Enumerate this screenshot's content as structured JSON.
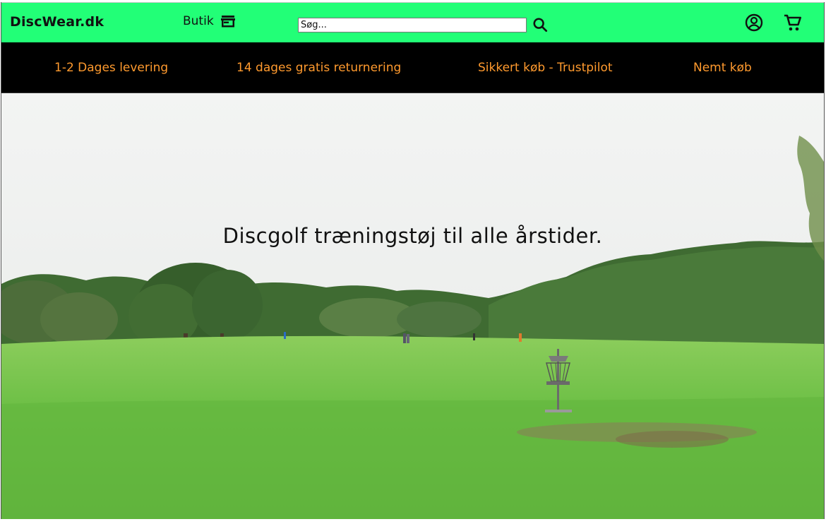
{
  "header": {
    "logo": "DiscWear.dk",
    "shop_label": "Butik",
    "shop_icon": "store-icon",
    "search": {
      "placeholder": "Søg...",
      "value": ""
    },
    "search_icon": "search-icon",
    "account_icon": "account-circle-icon",
    "cart_icon": "shopping-cart-icon",
    "background_color": "#22ff77"
  },
  "usp_bar": {
    "background_color": "#000000",
    "text_color": "#ff9a2e",
    "items": [
      {
        "label": "1-2 Dages levering"
      },
      {
        "label": "14 dages gratis returnering"
      },
      {
        "label": "Sikkert køb - Trustpilot"
      },
      {
        "label": "Nemt køb"
      }
    ]
  },
  "hero": {
    "title": "Discgolf træningstøj til alle årstider."
  }
}
